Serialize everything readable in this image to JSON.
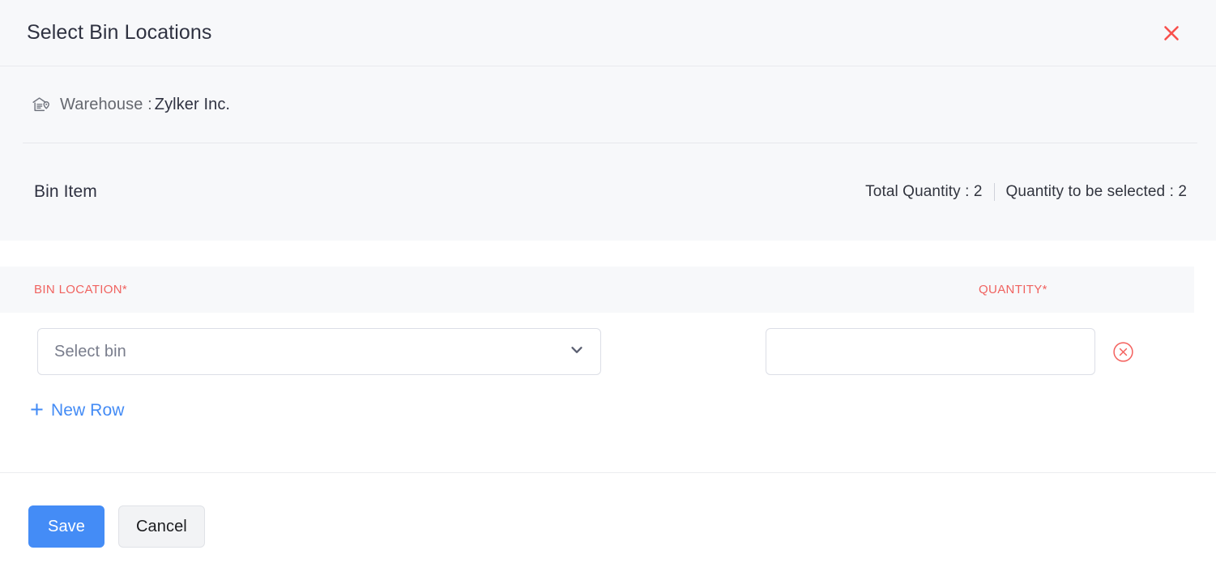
{
  "header": {
    "title": "Select Bin Locations",
    "close_icon": "close-icon"
  },
  "info": {
    "warehouse_icon": "warehouse-icon",
    "warehouse_label": "Warehouse :",
    "warehouse_value": "Zylker Inc.",
    "bin_item_title": "Bin Item",
    "total_quantity": "Total Quantity : 2",
    "quantity_to_be_selected": "Quantity to be selected : 2"
  },
  "table": {
    "columns": [
      {
        "label": "BIN LOCATION*"
      },
      {
        "label": "QUANTITY*"
      }
    ],
    "rows": [
      {
        "bin_location_placeholder": "Select bin",
        "bin_location_value": "",
        "quantity_value": "",
        "quantity_placeholder": "",
        "dropdown_icon": "chevron-down-icon",
        "delete_icon": "circle-x-icon"
      }
    ],
    "new_row_label": "New Row",
    "new_row_icon": "plus-icon"
  },
  "footer": {
    "save_label": "Save",
    "cancel_label": "Cancel"
  },
  "colors": {
    "accent_blue": "#448cf6",
    "required_red": "#f06360",
    "close_red": "#f8504c",
    "panel_bg": "#f7f8fa",
    "border": "#dcdee6"
  }
}
